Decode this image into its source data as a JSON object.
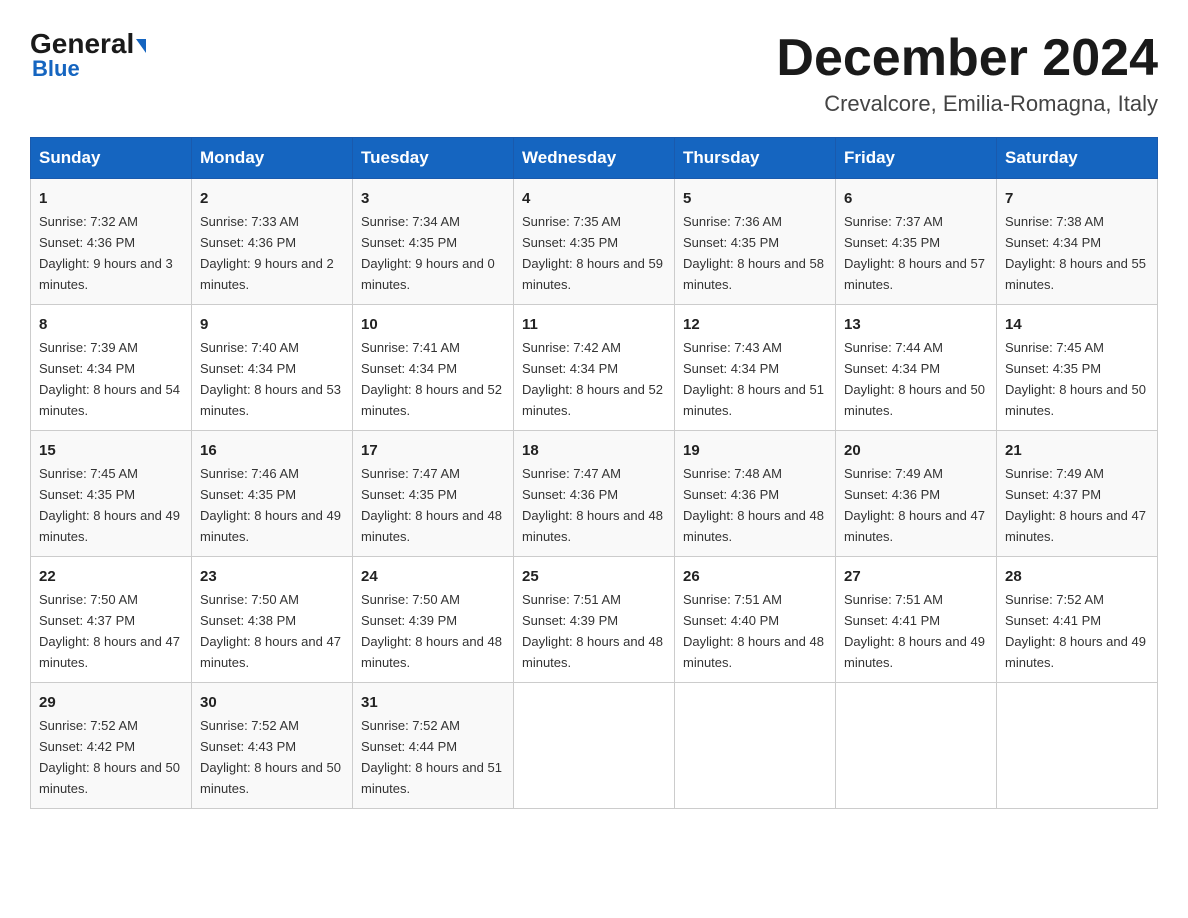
{
  "header": {
    "logo_line1": "General",
    "logo_line2": "Blue",
    "month_title": "December 2024",
    "subtitle": "Crevalcore, Emilia-Romagna, Italy"
  },
  "days_of_week": [
    "Sunday",
    "Monday",
    "Tuesday",
    "Wednesday",
    "Thursday",
    "Friday",
    "Saturday"
  ],
  "weeks": [
    [
      {
        "day": "1",
        "sunrise": "7:32 AM",
        "sunset": "4:36 PM",
        "daylight": "9 hours and 3 minutes."
      },
      {
        "day": "2",
        "sunrise": "7:33 AM",
        "sunset": "4:36 PM",
        "daylight": "9 hours and 2 minutes."
      },
      {
        "day": "3",
        "sunrise": "7:34 AM",
        "sunset": "4:35 PM",
        "daylight": "9 hours and 0 minutes."
      },
      {
        "day": "4",
        "sunrise": "7:35 AM",
        "sunset": "4:35 PM",
        "daylight": "8 hours and 59 minutes."
      },
      {
        "day": "5",
        "sunrise": "7:36 AM",
        "sunset": "4:35 PM",
        "daylight": "8 hours and 58 minutes."
      },
      {
        "day": "6",
        "sunrise": "7:37 AM",
        "sunset": "4:35 PM",
        "daylight": "8 hours and 57 minutes."
      },
      {
        "day": "7",
        "sunrise": "7:38 AM",
        "sunset": "4:34 PM",
        "daylight": "8 hours and 55 minutes."
      }
    ],
    [
      {
        "day": "8",
        "sunrise": "7:39 AM",
        "sunset": "4:34 PM",
        "daylight": "8 hours and 54 minutes."
      },
      {
        "day": "9",
        "sunrise": "7:40 AM",
        "sunset": "4:34 PM",
        "daylight": "8 hours and 53 minutes."
      },
      {
        "day": "10",
        "sunrise": "7:41 AM",
        "sunset": "4:34 PM",
        "daylight": "8 hours and 52 minutes."
      },
      {
        "day": "11",
        "sunrise": "7:42 AM",
        "sunset": "4:34 PM",
        "daylight": "8 hours and 52 minutes."
      },
      {
        "day": "12",
        "sunrise": "7:43 AM",
        "sunset": "4:34 PM",
        "daylight": "8 hours and 51 minutes."
      },
      {
        "day": "13",
        "sunrise": "7:44 AM",
        "sunset": "4:34 PM",
        "daylight": "8 hours and 50 minutes."
      },
      {
        "day": "14",
        "sunrise": "7:45 AM",
        "sunset": "4:35 PM",
        "daylight": "8 hours and 50 minutes."
      }
    ],
    [
      {
        "day": "15",
        "sunrise": "7:45 AM",
        "sunset": "4:35 PM",
        "daylight": "8 hours and 49 minutes."
      },
      {
        "day": "16",
        "sunrise": "7:46 AM",
        "sunset": "4:35 PM",
        "daylight": "8 hours and 49 minutes."
      },
      {
        "day": "17",
        "sunrise": "7:47 AM",
        "sunset": "4:35 PM",
        "daylight": "8 hours and 48 minutes."
      },
      {
        "day": "18",
        "sunrise": "7:47 AM",
        "sunset": "4:36 PM",
        "daylight": "8 hours and 48 minutes."
      },
      {
        "day": "19",
        "sunrise": "7:48 AM",
        "sunset": "4:36 PM",
        "daylight": "8 hours and 48 minutes."
      },
      {
        "day": "20",
        "sunrise": "7:49 AM",
        "sunset": "4:36 PM",
        "daylight": "8 hours and 47 minutes."
      },
      {
        "day": "21",
        "sunrise": "7:49 AM",
        "sunset": "4:37 PM",
        "daylight": "8 hours and 47 minutes."
      }
    ],
    [
      {
        "day": "22",
        "sunrise": "7:50 AM",
        "sunset": "4:37 PM",
        "daylight": "8 hours and 47 minutes."
      },
      {
        "day": "23",
        "sunrise": "7:50 AM",
        "sunset": "4:38 PM",
        "daylight": "8 hours and 47 minutes."
      },
      {
        "day": "24",
        "sunrise": "7:50 AM",
        "sunset": "4:39 PM",
        "daylight": "8 hours and 48 minutes."
      },
      {
        "day": "25",
        "sunrise": "7:51 AM",
        "sunset": "4:39 PM",
        "daylight": "8 hours and 48 minutes."
      },
      {
        "day": "26",
        "sunrise": "7:51 AM",
        "sunset": "4:40 PM",
        "daylight": "8 hours and 48 minutes."
      },
      {
        "day": "27",
        "sunrise": "7:51 AM",
        "sunset": "4:41 PM",
        "daylight": "8 hours and 49 minutes."
      },
      {
        "day": "28",
        "sunrise": "7:52 AM",
        "sunset": "4:41 PM",
        "daylight": "8 hours and 49 minutes."
      }
    ],
    [
      {
        "day": "29",
        "sunrise": "7:52 AM",
        "sunset": "4:42 PM",
        "daylight": "8 hours and 50 minutes."
      },
      {
        "day": "30",
        "sunrise": "7:52 AM",
        "sunset": "4:43 PM",
        "daylight": "8 hours and 50 minutes."
      },
      {
        "day": "31",
        "sunrise": "7:52 AM",
        "sunset": "4:44 PM",
        "daylight": "8 hours and 51 minutes."
      },
      null,
      null,
      null,
      null
    ]
  ],
  "labels": {
    "sunrise": "Sunrise:",
    "sunset": "Sunset:",
    "daylight": "Daylight:"
  }
}
